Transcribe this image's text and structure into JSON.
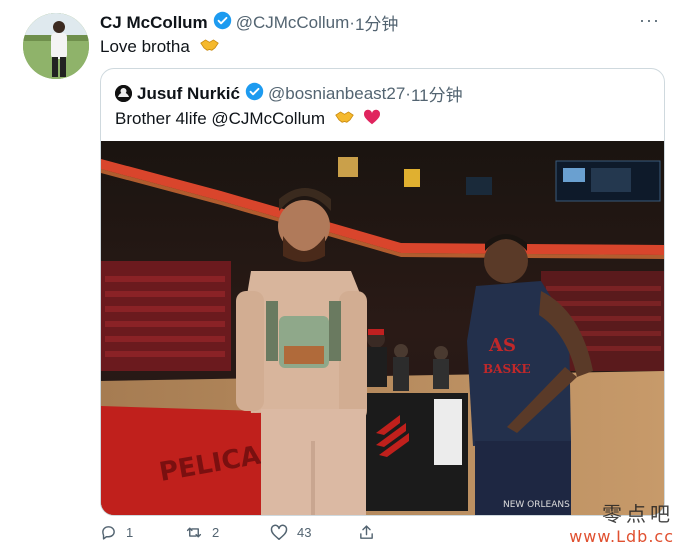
{
  "tweet": {
    "author_name": "CJ McCollum",
    "handle": "@CJMcCollum",
    "separator": "·",
    "time": "1分钟",
    "text": "Love brotha",
    "emoji": "handshake-emoji",
    "more": "···"
  },
  "quoted": {
    "author_name": "Jusuf Nurkić",
    "handle": "@bosnianbeast27",
    "separator": "·",
    "time": "11分钟",
    "text": "Brother 4life @CJMcCollum",
    "emojis": [
      "handshake-emoji",
      "red-heart-emoji"
    ],
    "photo_text": {
      "court": "PELICA",
      "jersey_line1": "AS",
      "jersey_line2": "BASKE",
      "shorts": "NEW ORLEANS"
    }
  },
  "actions": {
    "reply_count": "1",
    "retweet_count": "2",
    "like_count": "43"
  },
  "watermark": {
    "chinese": "零点吧",
    "url": "www.Ldb.cc"
  },
  "colors": {
    "verified": "#1d9bf0",
    "secondary_text": "#536471",
    "border": "#cfd9de",
    "heart": "#e0245e"
  }
}
